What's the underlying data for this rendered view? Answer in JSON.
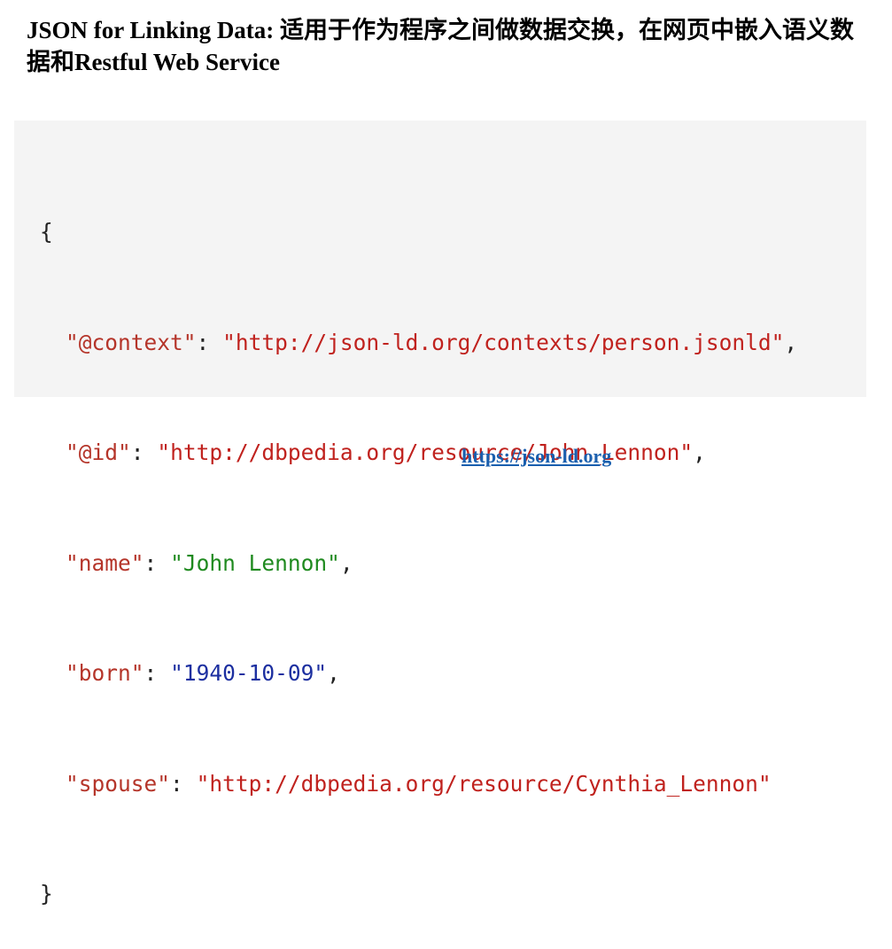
{
  "heading": "JSON for Linking Data: 适用于作为程序之间做数据交换，在网页中嵌入语义数据和Restful Web Service",
  "code": {
    "open_brace": "{",
    "close_brace": "}",
    "entries": [
      {
        "key": "@context",
        "value": "http://json-ld.org/contexts/person.jsonld",
        "trail": ","
      },
      {
        "key": "@id",
        "value": "http://dbpedia.org/resource/John_Lennon",
        "trail": ","
      },
      {
        "key": "name",
        "value": "John Lennon",
        "trail": ","
      },
      {
        "key": "born",
        "value": "1940-10-09",
        "trail": ","
      },
      {
        "key": "spouse",
        "value": "http://dbpedia.org/resource/Cynthia_Lennon",
        "trail": ""
      }
    ]
  },
  "footer_link": "https://json-ld.org",
  "colors": {
    "key": "#b5352a",
    "url": "#c0221e",
    "string": "#1f8a1f",
    "date": "#1c2fa0",
    "link": "#1a5fae",
    "code_background": "#f4f4f4"
  }
}
